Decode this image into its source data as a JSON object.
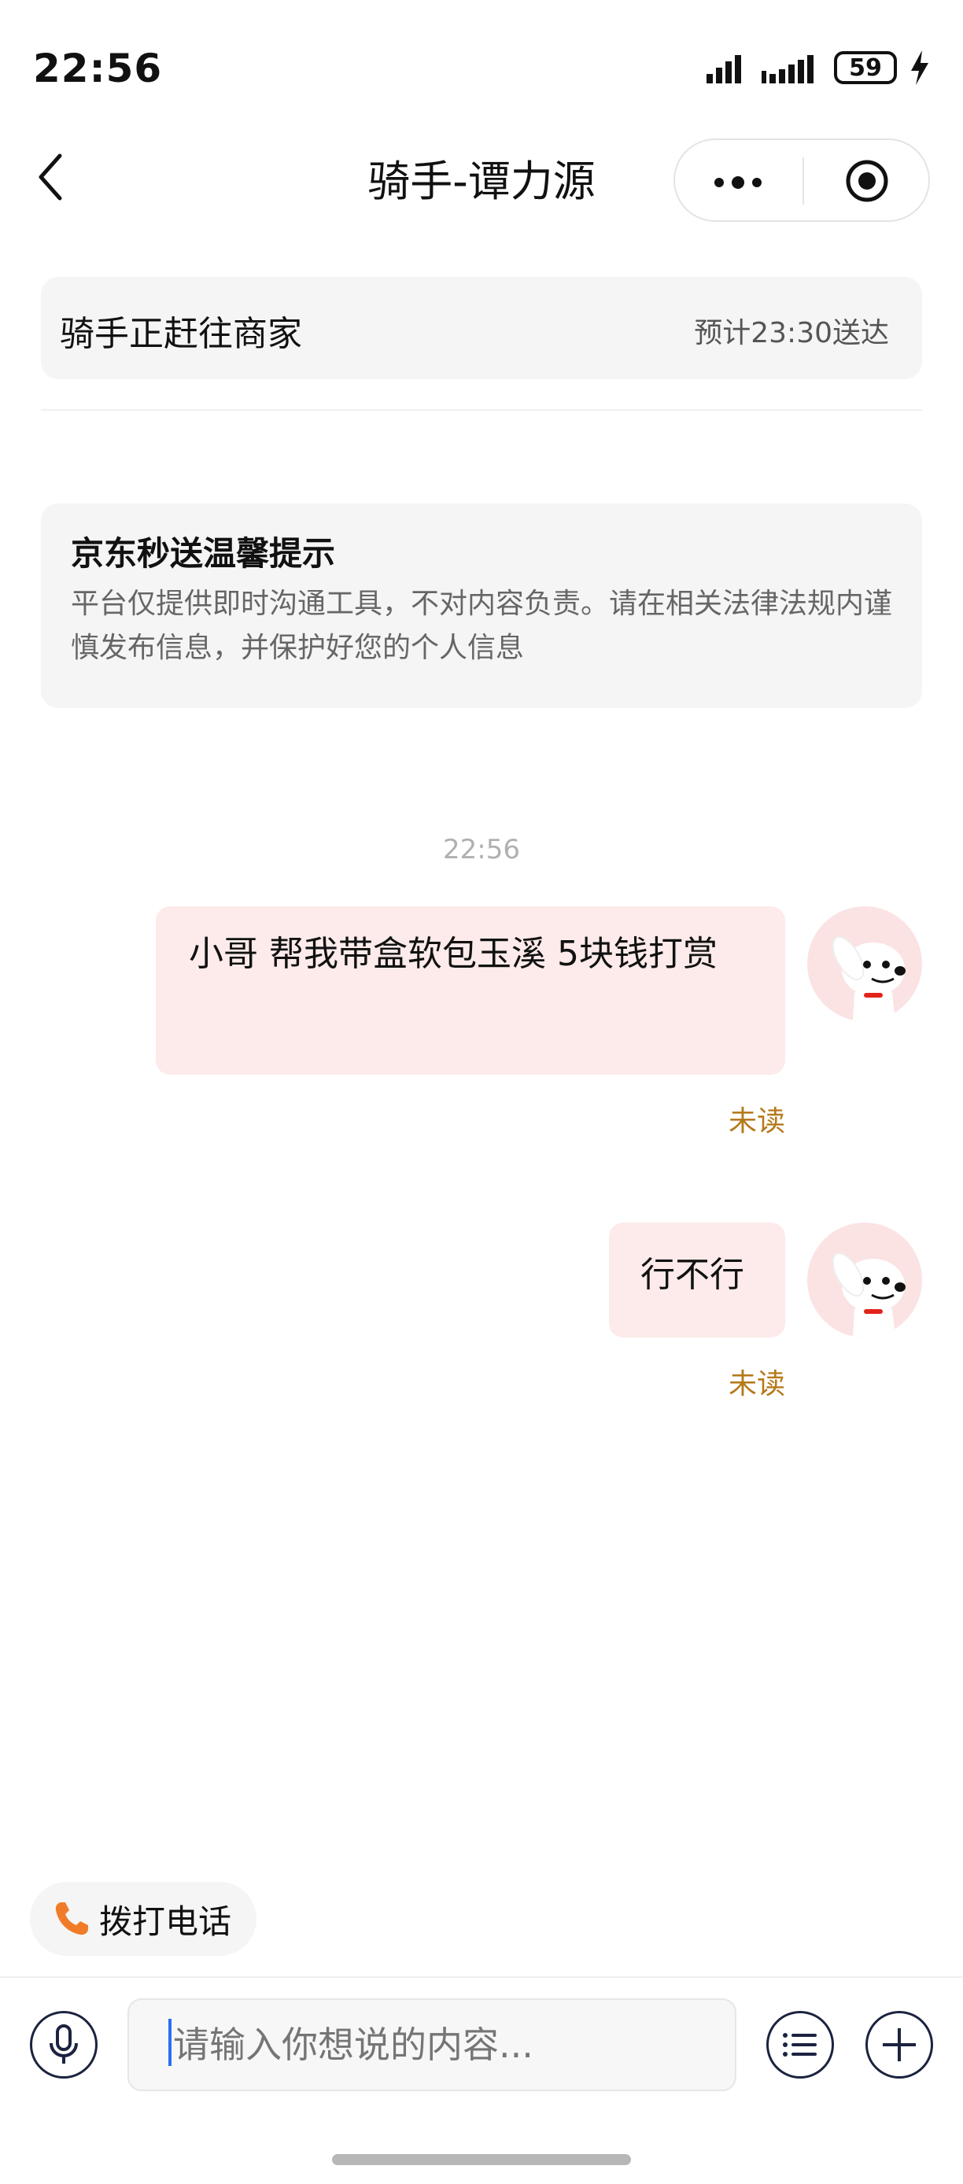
{
  "status_bar": {
    "time": "22:56",
    "battery": "59"
  },
  "nav": {
    "title": "骑手-谭力源"
  },
  "order_status": {
    "text": "骑手正赶往商家",
    "eta": "预计23:30送达"
  },
  "notice": {
    "title": "京东秒送温馨提示",
    "body": "平台仅提供即时沟通工具，不对内容负责。请在相关法律法规内谨慎发布信息，并保护好您的个人信息"
  },
  "chat": {
    "timestamp": "22:56",
    "messages": [
      {
        "text": "小哥 帮我带盒软包玉溪 5块钱打赏",
        "status": "未读"
      },
      {
        "text": "行不行",
        "status": "未读"
      }
    ]
  },
  "call_chip": {
    "label": "拨打电话"
  },
  "input": {
    "placeholder": "请输入你想说的内容..."
  },
  "colors": {
    "bubble": "#fcebea",
    "unread": "#b5791a",
    "call_icon": "#f07c2a"
  }
}
